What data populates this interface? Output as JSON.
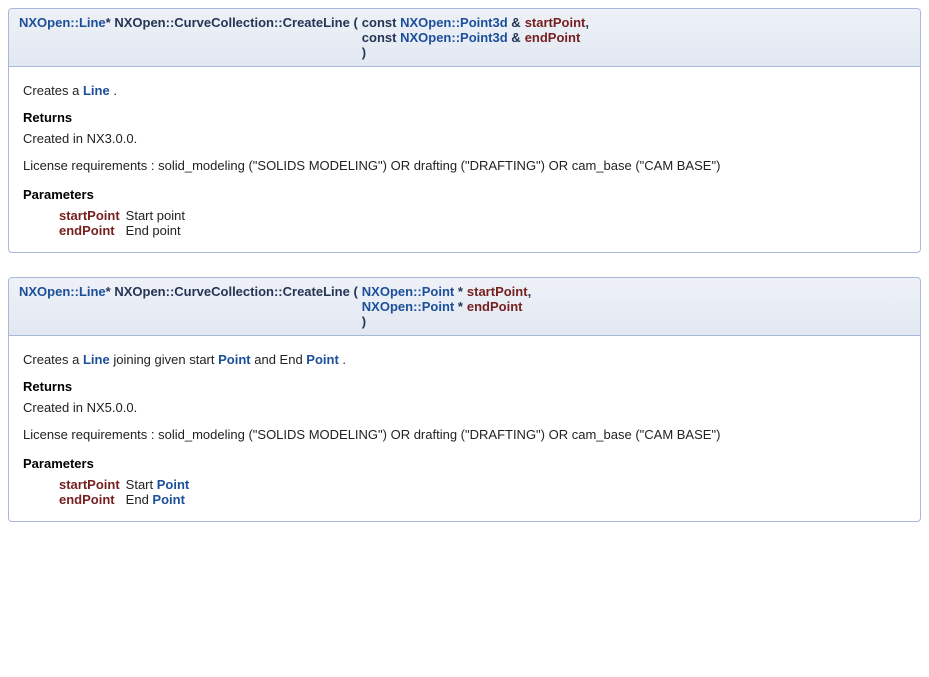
{
  "methods": [
    {
      "signature": {
        "return_type_link": "NXOpen::Line",
        "return_type_suffix": "* ",
        "class_name": "NXOpen::CurveCollection::CreateLine",
        "open_paren": " ( ",
        "params": [
          {
            "prefix": "const ",
            "type_link": "NXOpen::Point3d",
            "type_suffix": " & ",
            "name": "startPoint",
            "trailing": ","
          },
          {
            "prefix": "const ",
            "type_link": "NXOpen::Point3d",
            "type_suffix": " & ",
            "name": "endPoint",
            "trailing": ""
          }
        ],
        "close_paren": ")"
      },
      "description": {
        "pre": "Creates a ",
        "link": "Line",
        "post": " ."
      },
      "returns_label": "Returns",
      "created": "Created in NX3.0.0.",
      "license": "License requirements : solid_modeling (\"SOLIDS MODELING\") OR drafting (\"DRAFTING\") OR cam_base (\"CAM BASE\")",
      "parameters_label": "Parameters",
      "parameters": [
        {
          "name": "startPoint",
          "desc_pre": "Start point",
          "desc_link": "",
          "desc_post": ""
        },
        {
          "name": "endPoint",
          "desc_pre": "End point",
          "desc_link": "",
          "desc_post": ""
        }
      ]
    },
    {
      "signature": {
        "return_type_link": "NXOpen::Line",
        "return_type_suffix": "* ",
        "class_name": "NXOpen::CurveCollection::CreateLine",
        "open_paren": " ( ",
        "params": [
          {
            "prefix": "",
            "type_link": "NXOpen::Point",
            "type_suffix": " * ",
            "name": "startPoint",
            "trailing": ","
          },
          {
            "prefix": "",
            "type_link": "NXOpen::Point",
            "type_suffix": " * ",
            "name": "endPoint",
            "trailing": ""
          }
        ],
        "close_paren": ")"
      },
      "description": {
        "pre": "Creates a ",
        "link": "Line",
        "post_parts": [
          {
            "text": " joining given start "
          },
          {
            "link": "Point"
          },
          {
            "text": " and End "
          },
          {
            "link": "Point"
          },
          {
            "text": " ."
          }
        ]
      },
      "returns_label": "Returns",
      "created": "Created in NX5.0.0.",
      "license": "License requirements : solid_modeling (\"SOLIDS MODELING\") OR drafting (\"DRAFTING\") OR cam_base (\"CAM BASE\")",
      "parameters_label": "Parameters",
      "parameters": [
        {
          "name": "startPoint",
          "desc_pre": "Start ",
          "desc_link": "Point",
          "desc_post": ""
        },
        {
          "name": "endPoint",
          "desc_pre": "End ",
          "desc_link": "Point",
          "desc_post": ""
        }
      ]
    }
  ]
}
